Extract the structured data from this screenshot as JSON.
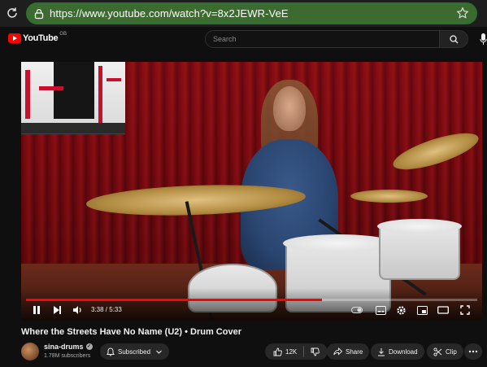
{
  "browser": {
    "url": "https://www.youtube.com/watch?v=8x2JEWR-VeE"
  },
  "header": {
    "logo_text": "YouTube",
    "country_code": "GB",
    "search_placeholder": "Search"
  },
  "player": {
    "time_current": "3:38",
    "time_total": "5:33",
    "time_display": "3:38 / 5:33",
    "progress_fraction": 0.655,
    "icons": [
      "play-pause-icon",
      "next-icon",
      "volume-icon",
      "settings-icon",
      "miniplayer-icon",
      "theater-icon",
      "fullscreen-icon"
    ]
  },
  "video": {
    "title": "Where the Streets Have No Name (U2) • Drum Cover"
  },
  "channel": {
    "name": "sina-drums",
    "subscribers": "1.78M subscribers",
    "subscribe_label": "Subscribed"
  },
  "actions": {
    "like_count": "12K",
    "share_label": "Share",
    "download_label": "Download",
    "clip_label": "Clip"
  },
  "colors": {
    "accent": "#ff0000",
    "url_bar": "#3b6b2e",
    "background": "#0f0f0f"
  }
}
